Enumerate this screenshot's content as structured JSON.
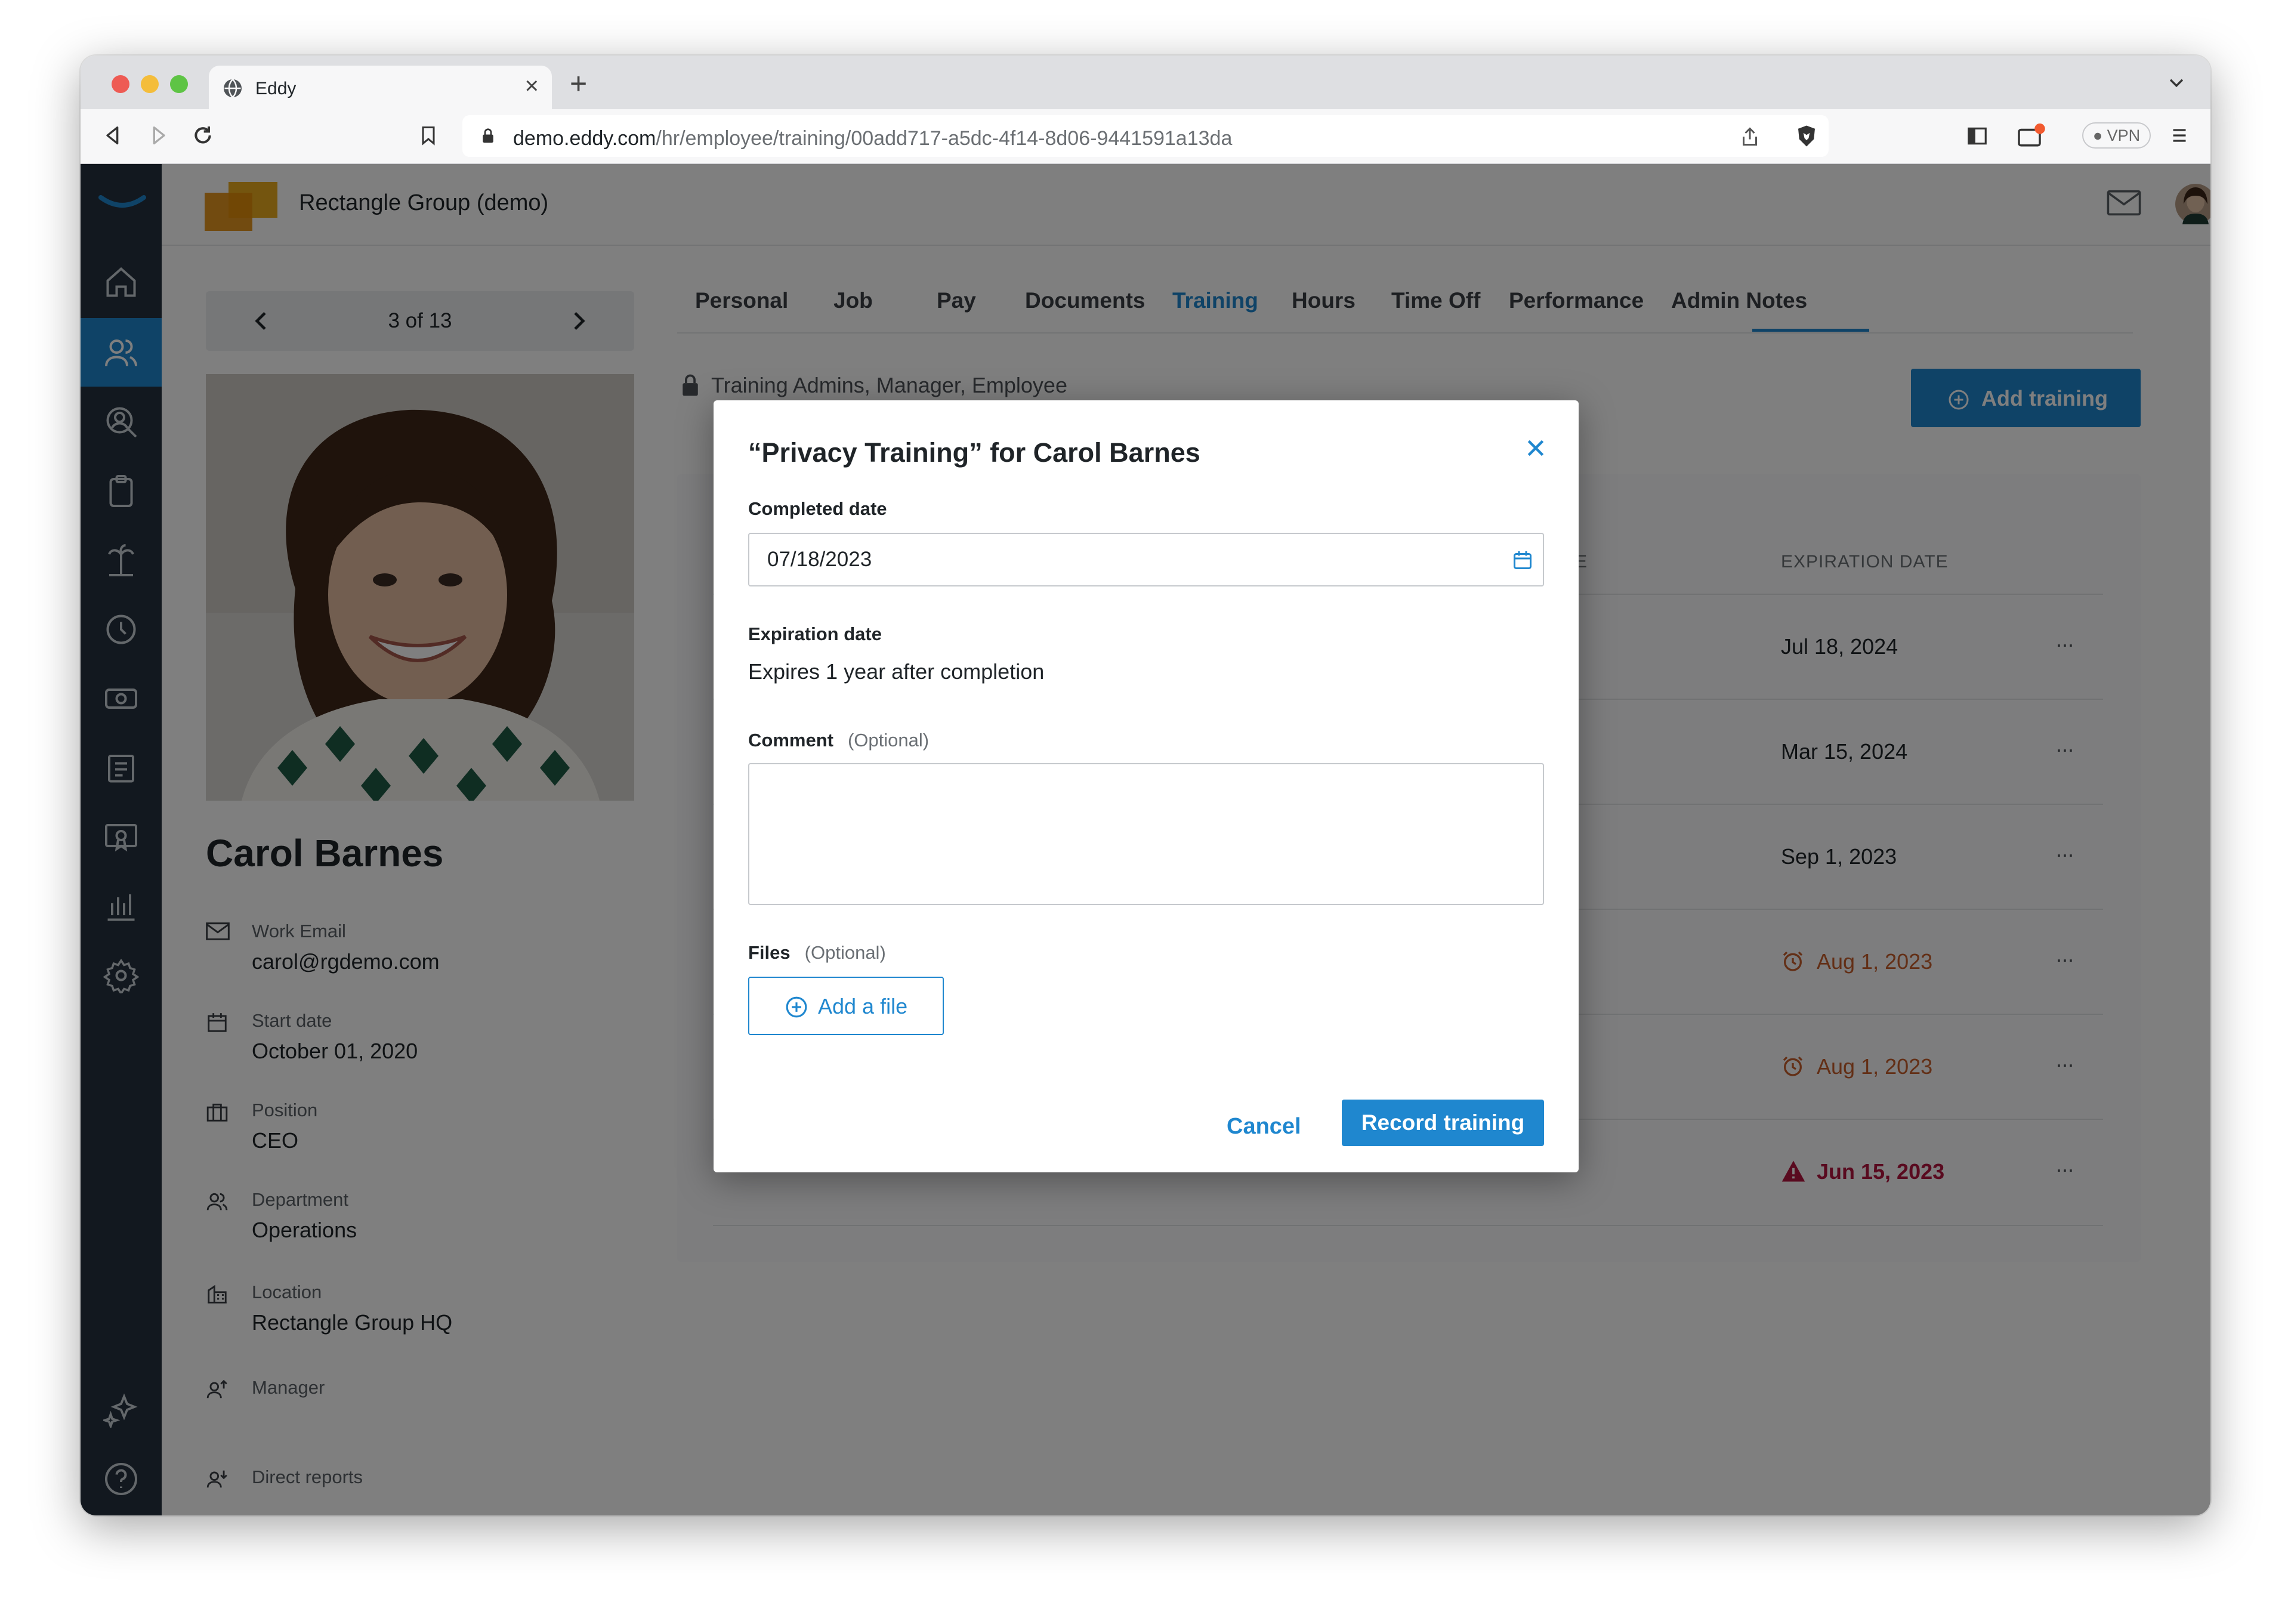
{
  "browser": {
    "tab_title": "Eddy",
    "url_host": "demo.eddy.com",
    "url_path": "/hr/employee/training/00add717-a5dc-4f14-8d06-9441591a13da",
    "vpn_label": "VPN"
  },
  "header": {
    "company": "Rectangle Group (demo)"
  },
  "sidebar": {
    "items": [
      "home-icon",
      "people-icon",
      "search-person-icon",
      "clipboard-icon",
      "beach-icon",
      "clock-icon",
      "money-icon",
      "documents-icon",
      "certificate-icon",
      "chart-icon",
      "gear-icon",
      "sparkle-icon",
      "help-icon"
    ],
    "active_index": 1,
    "active_color": "#1f87cf"
  },
  "pager": {
    "text": "3 of 13"
  },
  "employee": {
    "name": "Carol Barnes",
    "fields": [
      {
        "label": "Work Email",
        "value": "carol@rgdemo.com"
      },
      {
        "label": "Start date",
        "value": "October 01, 2020"
      },
      {
        "label": "Position",
        "value": "CEO"
      },
      {
        "label": "Department",
        "value": "Operations"
      },
      {
        "label": "Location",
        "value": "Rectangle Group HQ"
      },
      {
        "label": "Manager",
        "value": ""
      },
      {
        "label": "Direct reports",
        "value": ""
      }
    ]
  },
  "tabs": [
    "Personal",
    "Job",
    "Pay",
    "Documents",
    "Training",
    "Hours",
    "Time Off",
    "Performance",
    "Admin Notes"
  ],
  "active_tab": "Training",
  "training": {
    "access": "Training Admins, Manager, Employee",
    "add_button": "Add training",
    "columns": [
      "E",
      "EXPIRATION DATE"
    ],
    "rows": [
      {
        "expiration": "Jul 18, 2024",
        "status": "ok"
      },
      {
        "expiration": "Mar 15, 2024",
        "status": "ok"
      },
      {
        "expiration": "Sep 1, 2023",
        "status": "ok"
      },
      {
        "expiration": "Aug 1, 2023",
        "status": "warning"
      },
      {
        "expiration": "Aug 1, 2023",
        "status": "warning"
      },
      {
        "expiration": "Jun 15, 2023",
        "status": "expired"
      }
    ],
    "more": "···"
  },
  "modal": {
    "title": "“Privacy Training” for Carol Barnes",
    "completed_label": "Completed date",
    "completed_value": "07/18/2023",
    "expiration_label": "Expiration date",
    "expiration_text": "Expires 1 year after completion",
    "comment_label": "Comment",
    "comment_optional": "(Optional)",
    "files_label": "Files",
    "files_optional": "(Optional)",
    "add_file": "Add a file",
    "cancel": "Cancel",
    "record": "Record training"
  },
  "colors": {
    "accent": "#1f87cf",
    "warning": "#c65f2c",
    "danger": "#b3143f",
    "sidebar": "#25313e"
  }
}
